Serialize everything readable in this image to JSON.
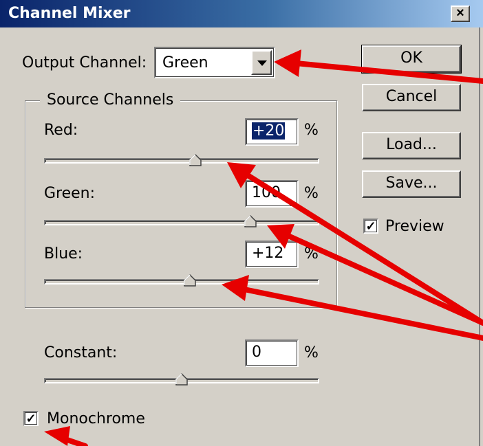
{
  "window": {
    "title": "Channel Mixer",
    "close_glyph": "×"
  },
  "output_channel": {
    "label": "Output Channel:",
    "selected": "Green"
  },
  "source_channels": {
    "title": "Source Channels",
    "channels": [
      {
        "label": "Red:",
        "value": "+20",
        "unit": "%",
        "slider_percent": 20
      },
      {
        "label": "Green:",
        "value": "100",
        "unit": "%",
        "slider_percent": 100
      },
      {
        "label": "Blue:",
        "value": "+12",
        "unit": "%",
        "slider_percent": 12
      }
    ]
  },
  "constant": {
    "label": "Constant:",
    "value": "0",
    "unit": "%",
    "slider_percent": 0
  },
  "buttons": {
    "ok": "OK",
    "cancel": "Cancel",
    "load": "Load...",
    "save": "Save..."
  },
  "preview": {
    "label": "Preview",
    "checked": true
  },
  "monochrome": {
    "label": "Monochrome",
    "checked": true
  },
  "annotation_color": "#e60000"
}
